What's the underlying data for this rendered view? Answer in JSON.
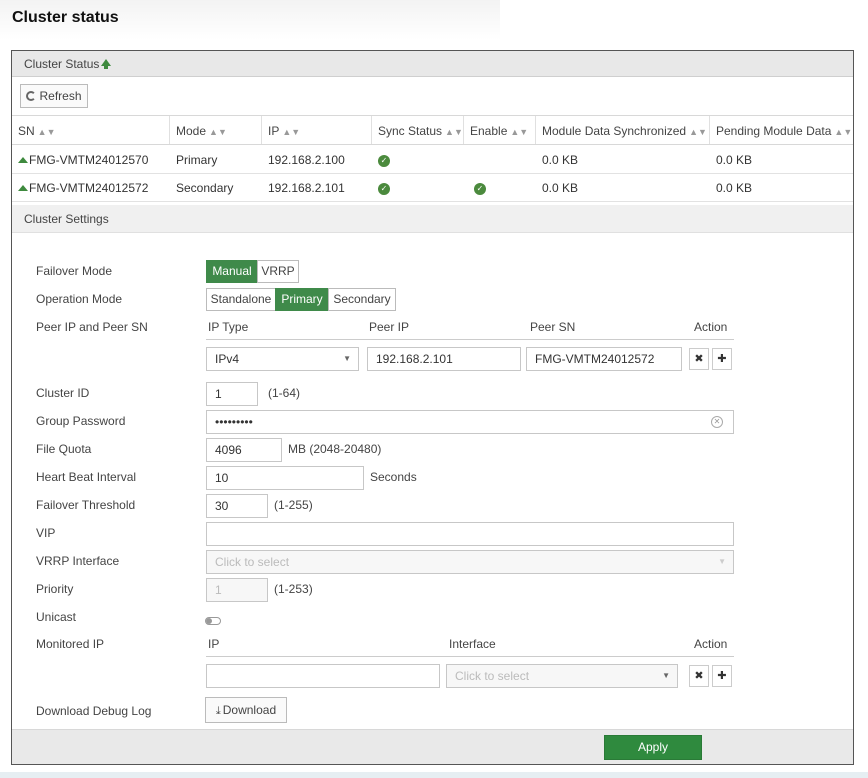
{
  "page": {
    "title": "Cluster status"
  },
  "panel": {
    "title": "Cluster Status",
    "refresh_label": "Refresh",
    "columns": [
      "SN",
      "Mode",
      "IP",
      "Sync Status",
      "Enable",
      "Module Data Synchronized",
      "Pending Module Data"
    ],
    "rows": [
      {
        "sn": "FMG-VMTM24012570",
        "mode": "Primary",
        "ip": "192.168.2.100",
        "sync": "ok",
        "enable": "",
        "module_data_sync": "0.0 KB",
        "pending": "0.0 KB"
      },
      {
        "sn": "FMG-VMTM24012572",
        "mode": "Secondary",
        "ip": "192.168.2.101",
        "sync": "ok",
        "enable": "ok",
        "module_data_sync": "0.0 KB",
        "pending": "0.0 KB"
      }
    ]
  },
  "settings": {
    "title": "Cluster Settings",
    "failover_mode": {
      "label": "Failover Mode",
      "options": [
        "Manual",
        "VRRP"
      ],
      "selected": "Manual"
    },
    "operation_mode": {
      "label": "Operation Mode",
      "options": [
        "Standalone",
        "Primary",
        "Secondary"
      ],
      "selected": "Primary"
    },
    "peer": {
      "label": "Peer IP and Peer SN",
      "col_ip_type": "IP Type",
      "col_peer_ip": "Peer IP",
      "col_peer_sn": "Peer SN",
      "col_action": "Action",
      "ip_type": "IPv4",
      "peer_ip": "192.168.2.101",
      "peer_sn": "FMG-VMTM24012572"
    },
    "cluster_id": {
      "label": "Cluster ID",
      "value": "1",
      "hint": "(1-64)"
    },
    "group_password": {
      "label": "Group Password",
      "value": "•••••••••"
    },
    "file_quota": {
      "label": "File Quota",
      "value": "4096",
      "hint": "MB (2048-20480)"
    },
    "heart_beat": {
      "label": "Heart Beat Interval",
      "value": "10",
      "hint": "Seconds"
    },
    "failover_threshold": {
      "label": "Failover Threshold",
      "value": "30",
      "hint": "(1-255)"
    },
    "vip": {
      "label": "VIP",
      "value": ""
    },
    "vrrp_interface": {
      "label": "VRRP Interface",
      "placeholder": "Click to select"
    },
    "priority": {
      "label": "Priority",
      "value": "1",
      "hint": "(1-253)"
    },
    "unicast": {
      "label": "Unicast",
      "enabled": false
    },
    "monitored_ip": {
      "label": "Monitored IP",
      "col_ip": "IP",
      "col_interface": "Interface",
      "col_action": "Action",
      "ip_value": "",
      "interface_placeholder": "Click to select"
    },
    "debug_log": {
      "label": "Download Debug Log",
      "button": "Download"
    }
  },
  "footer": {
    "apply_label": "Apply"
  },
  "colors": {
    "accent": "#3f8a4a",
    "apply": "#2f8a3e"
  }
}
